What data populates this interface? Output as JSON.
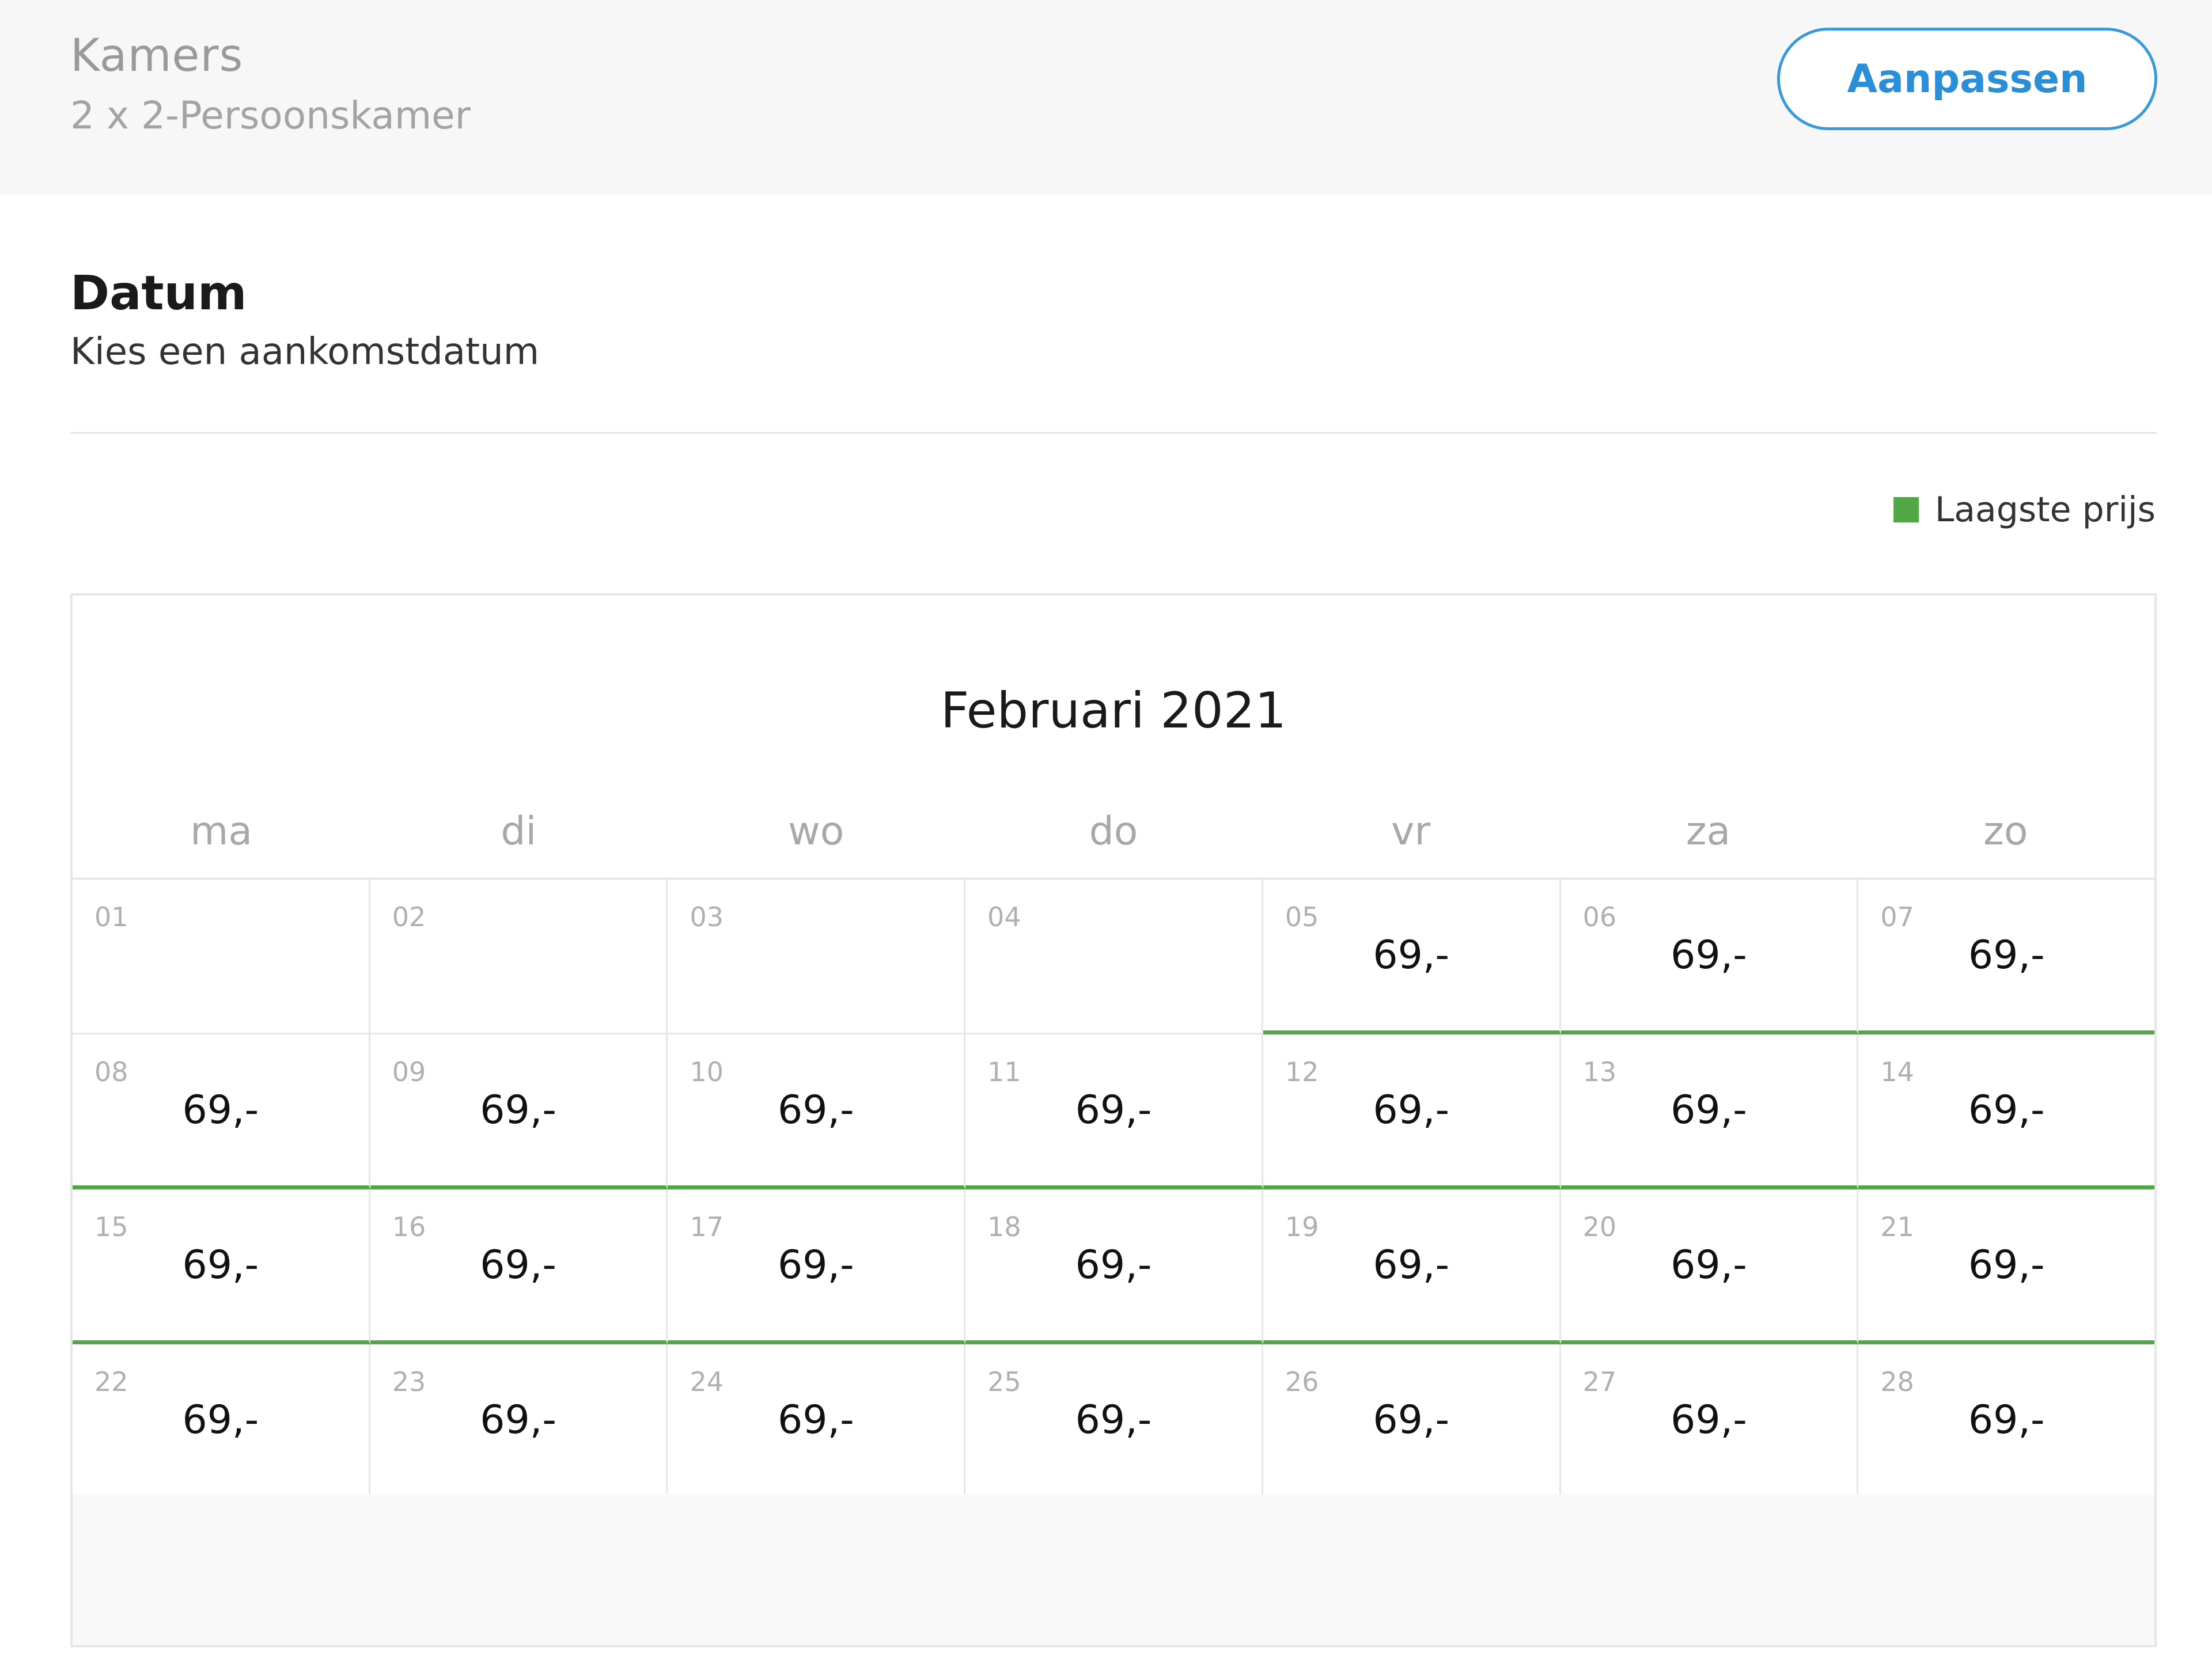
{
  "rooms": {
    "title": "Kamers",
    "subtitle": "2 x 2-Persoonskamer",
    "adjust_label": "Aanpassen"
  },
  "date_section": {
    "title": "Datum",
    "subtitle": "Kies een aankomstdatum"
  },
  "legend": {
    "label": "Laagste prijs",
    "color": "#4fa844"
  },
  "calendar": {
    "month": "Februari 2021",
    "weekdays": [
      "ma",
      "di",
      "wo",
      "do",
      "vr",
      "za",
      "zo"
    ],
    "weeks": [
      [
        {
          "day": "01",
          "price": ""
        },
        {
          "day": "02",
          "price": ""
        },
        {
          "day": "03",
          "price": ""
        },
        {
          "day": "04",
          "price": ""
        },
        {
          "day": "05",
          "price": "69,-"
        },
        {
          "day": "06",
          "price": "69,-"
        },
        {
          "day": "07",
          "price": "69,-"
        }
      ],
      [
        {
          "day": "08",
          "price": "69,-"
        },
        {
          "day": "09",
          "price": "69,-"
        },
        {
          "day": "10",
          "price": "69,-"
        },
        {
          "day": "11",
          "price": "69,-"
        },
        {
          "day": "12",
          "price": "69,-"
        },
        {
          "day": "13",
          "price": "69,-"
        },
        {
          "day": "14",
          "price": "69,-"
        }
      ],
      [
        {
          "day": "15",
          "price": "69,-"
        },
        {
          "day": "16",
          "price": "69,-"
        },
        {
          "day": "17",
          "price": "69,-"
        },
        {
          "day": "18",
          "price": "69,-"
        },
        {
          "day": "19",
          "price": "69,-"
        },
        {
          "day": "20",
          "price": "69,-"
        },
        {
          "day": "21",
          "price": "69,-"
        }
      ],
      [
        {
          "day": "22",
          "price": "69,-"
        },
        {
          "day": "23",
          "price": "69,-"
        },
        {
          "day": "24",
          "price": "69,-"
        },
        {
          "day": "25",
          "price": "69,-"
        },
        {
          "day": "26",
          "price": "69,-"
        },
        {
          "day": "27",
          "price": "69,-"
        },
        {
          "day": "28",
          "price": "69,-"
        }
      ]
    ]
  },
  "colors": {
    "accent_blue": "#2a8fd6",
    "lowest_price_green": "#4fa844"
  }
}
